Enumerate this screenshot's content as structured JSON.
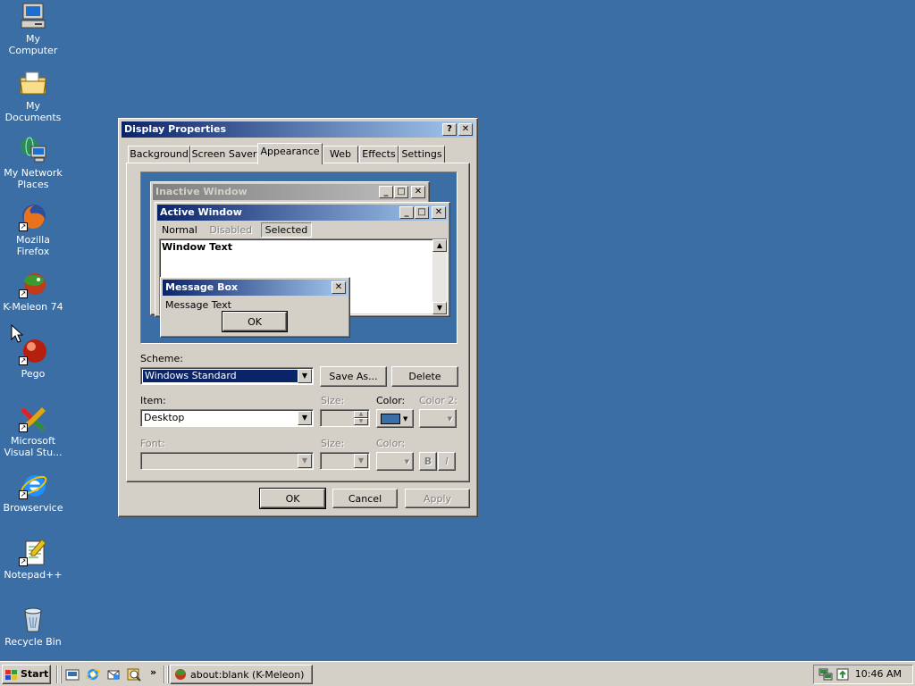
{
  "desktop": {
    "icons": [
      {
        "label": "My Computer",
        "icon": "computer-icon"
      },
      {
        "label": "My Documents",
        "icon": "folder-icon"
      },
      {
        "label": "My Network Places",
        "icon": "network-icon"
      },
      {
        "label": "Mozilla Firefox",
        "icon": "firefox-icon"
      },
      {
        "label": "K-Meleon 74",
        "icon": "kmeleon-icon"
      },
      {
        "label": "Pego",
        "icon": "pego-icon"
      },
      {
        "label": "Microsoft Visual Stu...",
        "icon": "visual-studio-icon"
      },
      {
        "label": "Browservice",
        "icon": "ie-icon"
      },
      {
        "label": "Notepad++",
        "icon": "notepad-icon"
      },
      {
        "label": "Recycle Bin",
        "icon": "recycle-bin-icon"
      }
    ]
  },
  "dialog": {
    "title": "Display Properties",
    "help_btn": "?",
    "close_btn": "✕",
    "tabs": [
      "Background",
      "Screen Saver",
      "Appearance",
      "Web",
      "Effects",
      "Settings"
    ],
    "active_tab": "Appearance",
    "preview": {
      "inactive_title": "Inactive Window",
      "active_title": "Active Window",
      "menu_items": [
        "Normal",
        "Disabled",
        "Selected"
      ],
      "window_text": "Window Text",
      "msgbox_title": "Message Box",
      "msgbox_text": "Message Text",
      "msgbox_ok": "OK"
    },
    "scheme_label": "Scheme:",
    "scheme_value": "Windows Standard",
    "save_as": "Save As...",
    "delete": "Delete",
    "item_label": "Item:",
    "item_value": "Desktop",
    "size_label": "Size:",
    "color_label": "Color:",
    "color2_label": "Color 2:",
    "font_label": "Font:",
    "font_size_label": "Size:",
    "font_color_label": "Color:",
    "bold_btn": "B",
    "italic_btn": "I",
    "desktop_color": "#3a6ea5",
    "ok": "OK",
    "cancel": "Cancel",
    "apply": "Apply"
  },
  "taskbar": {
    "start_label": "Start",
    "chevron": "»",
    "task_label": "about:blank (K-Meleon)",
    "clock": "10:46 AM"
  }
}
